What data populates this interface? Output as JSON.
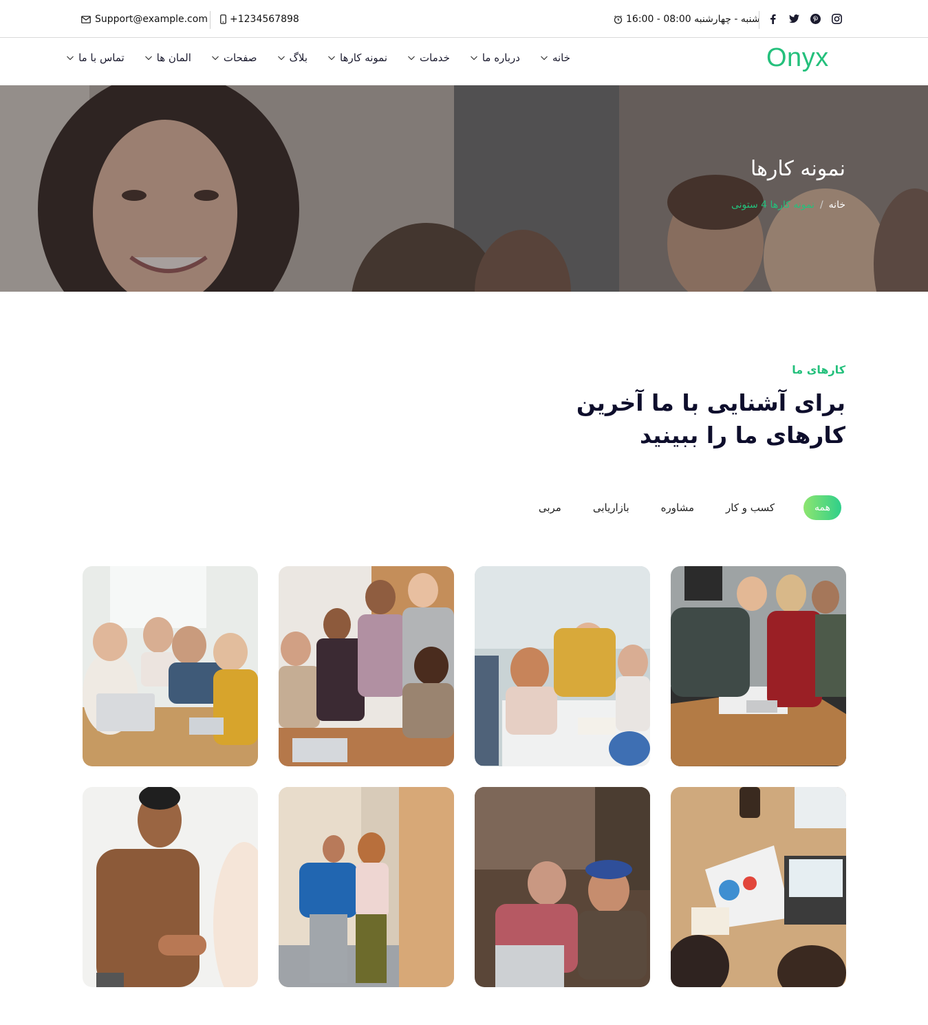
{
  "topbar": {
    "email": "Support@example.com",
    "phone": "+1234567898",
    "hours": "شنبه - چهارشنبه 08:00 - 16:00",
    "socials": [
      "instagram-icon",
      "pinterest-icon",
      "twitter-icon",
      "facebook-icon"
    ]
  },
  "nav": {
    "logo": "Onyx",
    "items": [
      {
        "label": "خانه"
      },
      {
        "label": "درباره ما"
      },
      {
        "label": "خدمات"
      },
      {
        "label": "نمونه کارها"
      },
      {
        "label": "بلاگ"
      },
      {
        "label": "صفحات"
      },
      {
        "label": "المان ها"
      },
      {
        "label": "تماس با ما"
      }
    ]
  },
  "hero": {
    "title": "نمونه کارها",
    "breadcrumb_home": "خانه",
    "breadcrumb_sep": "/",
    "breadcrumb_current": "نمونه کارها 4 ستونی"
  },
  "section": {
    "subtitle": "کارهای ما",
    "title": "برای آشنایی با ما آخرین کارهای ما را ببینید"
  },
  "filters": [
    {
      "label": "همه",
      "active": true
    },
    {
      "label": "کسب و کار"
    },
    {
      "label": "مشاوره"
    },
    {
      "label": "بازاریابی"
    },
    {
      "label": "مربی"
    }
  ],
  "colors": {
    "accent": "#24c07c",
    "title": "#0e0e2c"
  }
}
